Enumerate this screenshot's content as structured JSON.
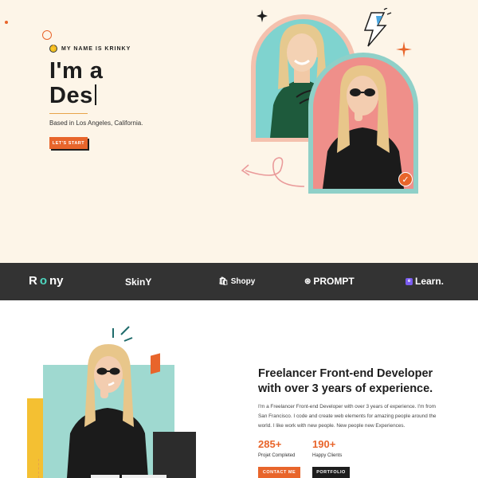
{
  "hero": {
    "eyebrow": "MY NAME IS KRINKY",
    "headline_line1": "I'm a",
    "headline_line2": "Des",
    "location": "Based in Los Angeles, California.",
    "cta_label": "LET'S START"
  },
  "brands": {
    "items": [
      {
        "label_a": "R",
        "label_o": "o",
        "label_b": "ny"
      },
      {
        "label": "SkinY"
      },
      {
        "label": "Shopy"
      },
      {
        "label": "PROMPT"
      },
      {
        "label": "Learn."
      }
    ]
  },
  "about": {
    "title_line1": "Freelancer Front-end Developer",
    "title_line2": "with over 3 years of experience.",
    "para_line1": "I'm a Freelancer Front-end Developer with over 3 years of experience. I'm from",
    "para_line2": "San Francisco. I code and create web elements for amazing people around the",
    "para_line3": "world. I like work with new people. New people new Experiences.",
    "stats": [
      {
        "number": "285+",
        "label": "Projet Completed"
      },
      {
        "number": "190+",
        "label": "Happy Clients"
      }
    ],
    "contact_label": "CONTACT ME",
    "portfolio_label": "PORTFOLIO"
  },
  "colors": {
    "accent": "#e8652b",
    "hero_bg": "#fdf5e8",
    "brand_bar": "#333333",
    "teal": "#9fd9d0",
    "pink": "#ef8f8a"
  }
}
